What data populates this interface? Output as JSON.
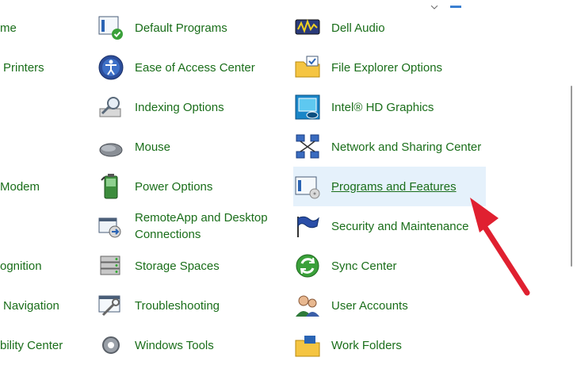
{
  "left_col": [
    {
      "name": "left-item-home",
      "label": "me"
    },
    {
      "name": "left-item-printers",
      "label": "Printers"
    },
    {
      "name": "left-item-modem",
      "label": "Modem"
    },
    {
      "name": "left-item-recognition",
      "label": "ognition"
    },
    {
      "name": "left-item-navigation",
      "label": "Navigation"
    },
    {
      "name": "left-item-mobility",
      "label": "bility Center"
    }
  ],
  "mid_col": [
    {
      "label": "Default Programs"
    },
    {
      "label": "Ease of Access Center"
    },
    {
      "label": "Indexing Options"
    },
    {
      "label": "Mouse"
    },
    {
      "label": "Power Options"
    },
    {
      "label": "RemoteApp and Desktop Connections"
    },
    {
      "label": "Storage Spaces"
    },
    {
      "label": "Troubleshooting"
    },
    {
      "label": "Windows Tools"
    }
  ],
  "right_col": [
    {
      "label": "Dell Audio"
    },
    {
      "label": "File Explorer Options"
    },
    {
      "label": "Intel® HD Graphics"
    },
    {
      "label": "Network and Sharing Center"
    },
    {
      "label": "Programs and Features"
    },
    {
      "label": "Security and Maintenance"
    },
    {
      "label": "Sync Center"
    },
    {
      "label": "User Accounts"
    },
    {
      "label": "Work Folders"
    }
  ],
  "colors": {
    "link": "#1a6e1a",
    "highlight": "#e5f1fb",
    "arrow": "#e02030"
  }
}
